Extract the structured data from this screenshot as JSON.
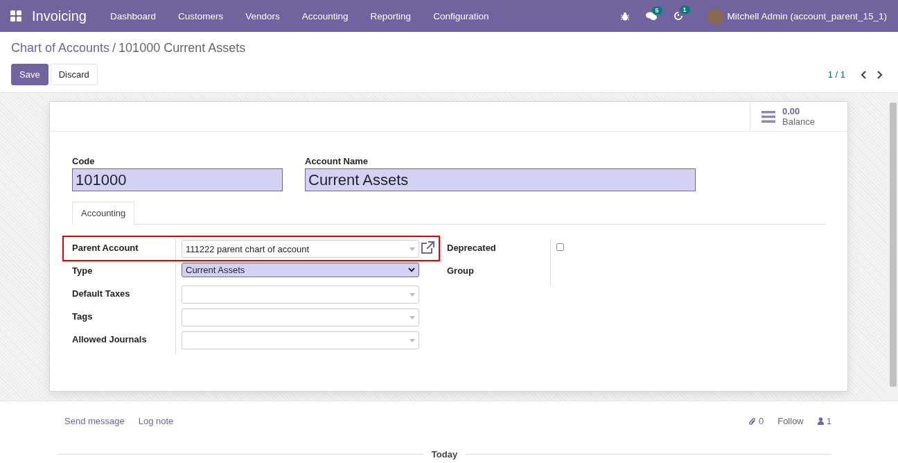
{
  "navbar": {
    "app_name": "Invoicing",
    "menus": [
      "Dashboard",
      "Customers",
      "Vendors",
      "Accounting",
      "Reporting",
      "Configuration"
    ],
    "messages_count": "5",
    "activities_count": "1",
    "user": "Mitchell Admin (account_parent_15_1)"
  },
  "breadcrumb": {
    "parent": "Chart of Accounts",
    "separator": "/",
    "current": "101000 Current Assets"
  },
  "buttons": [
    {
      "label": "Save",
      "kind": "primary"
    },
    {
      "label": "Discard",
      "kind": "secondary"
    }
  ],
  "pager": "1 / 1",
  "stat_button": {
    "value": "0.00",
    "label": "Balance"
  },
  "code": {
    "label": "Code",
    "value": "101000"
  },
  "account_name": {
    "label": "Account Name",
    "value": "Current Assets"
  },
  "tabs": [
    {
      "label": "Accounting",
      "selected": true
    }
  ],
  "left_fields": [
    {
      "label": "Parent Account",
      "kind": "many2one",
      "value": "111222 parent chart of account",
      "highlighted": true
    },
    {
      "label": "Type",
      "kind": "select",
      "value": "Current Assets",
      "highlighted": false
    },
    {
      "label": "Default Taxes",
      "kind": "many2one",
      "highlighted": false
    },
    {
      "label": "Tags",
      "kind": "many2one",
      "highlighted": false
    },
    {
      "label": "Allowed Journals",
      "kind": "many2one",
      "highlighted": false
    }
  ],
  "right_fields": [
    {
      "label": "Deprecated",
      "kind": "checkbox",
      "checked": false
    },
    {
      "label": "Group",
      "kind": "empty"
    }
  ],
  "chatter": {
    "actions": [
      "Send message",
      "Log note"
    ],
    "attachments": "0",
    "follow": "Follow",
    "followers": "1",
    "date_separator": "Today"
  }
}
